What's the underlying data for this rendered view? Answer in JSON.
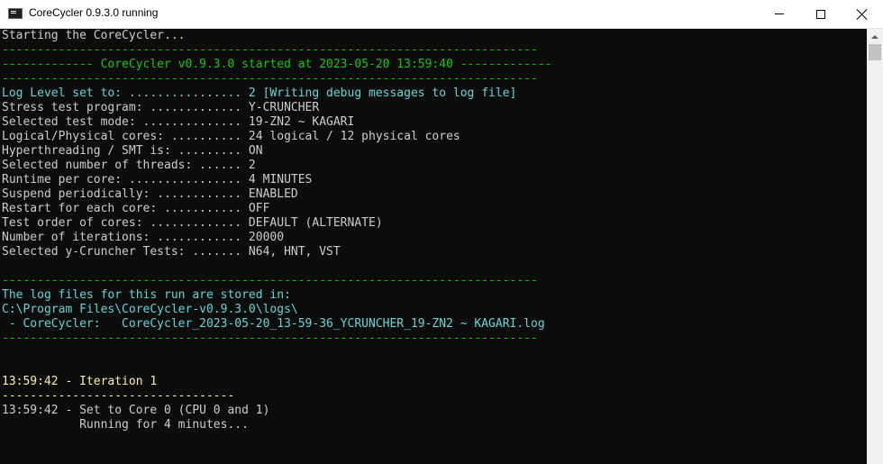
{
  "window": {
    "title": "CoreCycler 0.9.3.0 running"
  },
  "console_lines": [
    {
      "text": "Starting the CoreCycler...",
      "color": "w"
    },
    {
      "text": "----------------------------------------------------------------------------",
      "color": "g"
    },
    {
      "text": "------------- CoreCycler v0.9.3.0 started at 2023-05-20 13:59:40 -------------",
      "color": "g"
    },
    {
      "text": "----------------------------------------------------------------------------",
      "color": "g"
    },
    {
      "text": "Log Level set to: ................ 2 [Writing debug messages to log file]",
      "color": "c"
    },
    {
      "text": "Stress test program: ............. Y-CRUNCHER",
      "color": "w"
    },
    {
      "text": "Selected test mode: .............. 19-ZN2 ~ KAGARI",
      "color": "w"
    },
    {
      "text": "Logical/Physical cores: .......... 24 logical / 12 physical cores",
      "color": "w"
    },
    {
      "text": "Hyperthreading / SMT is: ......... ON",
      "color": "w"
    },
    {
      "text": "Selected number of threads: ...... 2",
      "color": "w"
    },
    {
      "text": "Runtime per core: ................ 4 MINUTES",
      "color": "w"
    },
    {
      "text": "Suspend periodically: ............ ENABLED",
      "color": "w"
    },
    {
      "text": "Restart for each core: ........... OFF",
      "color": "w"
    },
    {
      "text": "Test order of cores: ............. DEFAULT (ALTERNATE)",
      "color": "w"
    },
    {
      "text": "Number of iterations: ............ 20000",
      "color": "w"
    },
    {
      "text": "Selected y-Cruncher Tests: ....... N64, HNT, VST",
      "color": "w"
    },
    {
      "text": "",
      "color": "w"
    },
    {
      "text": "----------------------------------------------------------------------------",
      "color": "g"
    },
    {
      "text": "The log files for this run are stored in:",
      "color": "c"
    },
    {
      "text": "C:\\Program Files\\CoreCycler-v0.9.3.0\\logs\\",
      "color": "c"
    },
    {
      "text": " - CoreCycler:   CoreCycler_2023-05-20_13-59-36_YCRUNCHER_19-ZN2 ~ KAGARI.log",
      "color": "c"
    },
    {
      "text": "----------------------------------------------------------------------------",
      "color": "g"
    },
    {
      "text": "",
      "color": "w"
    },
    {
      "text": "",
      "color": "w"
    },
    {
      "text": "13:59:42 - Iteration 1",
      "color": "y"
    },
    {
      "text": "---------------------------------",
      "color": "y"
    },
    {
      "text": "13:59:42 - Set to Core 0 (CPU 0 and 1)",
      "color": "w"
    },
    {
      "text": "           Running for 4 minutes...",
      "color": "w"
    }
  ]
}
